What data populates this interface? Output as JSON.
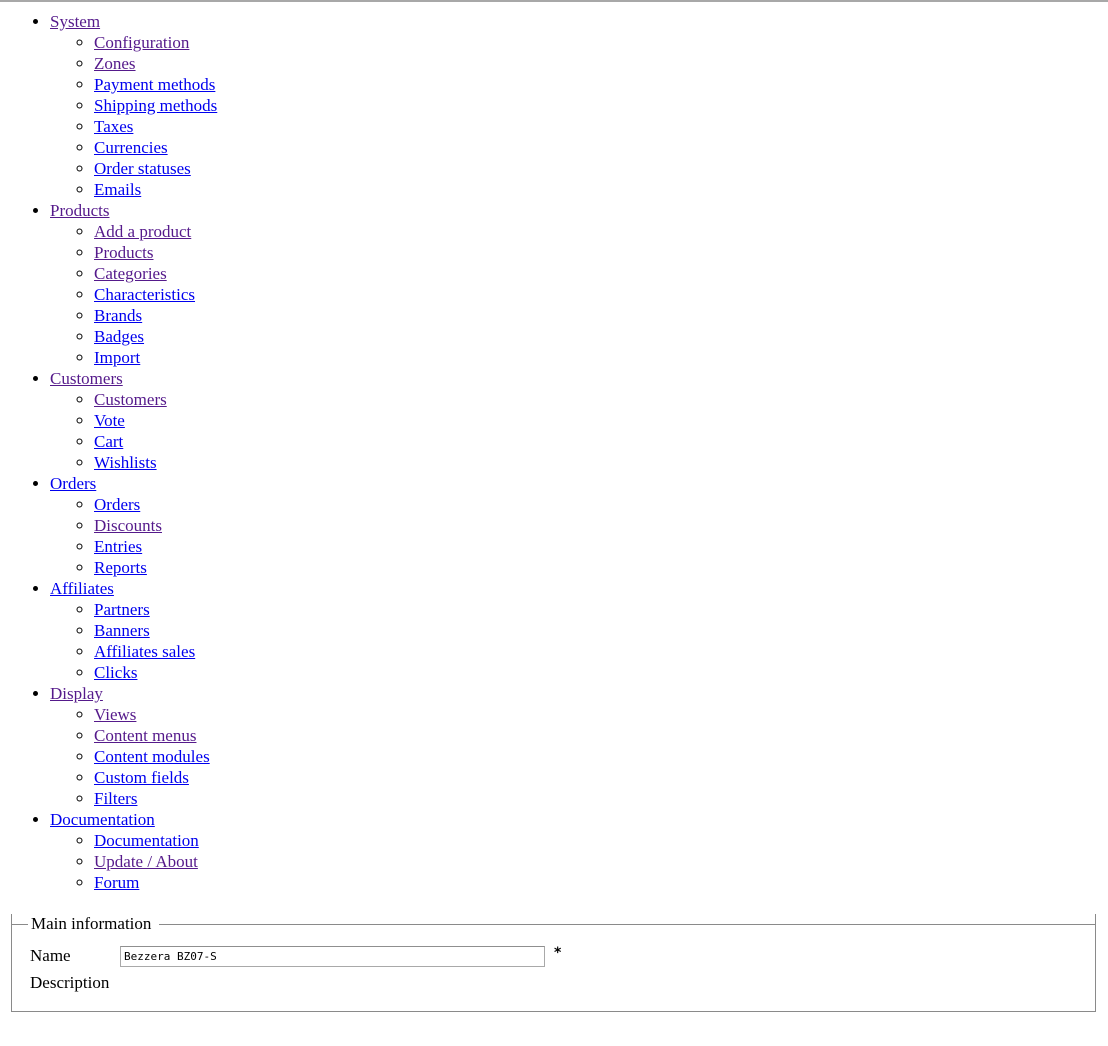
{
  "menu": [
    {
      "label": "System",
      "visited": true,
      "items": [
        {
          "label": "Configuration",
          "visited": true
        },
        {
          "label": "Zones",
          "visited": true
        },
        {
          "label": "Payment methods",
          "visited": false
        },
        {
          "label": "Shipping methods",
          "visited": false
        },
        {
          "label": "Taxes",
          "visited": false
        },
        {
          "label": "Currencies",
          "visited": false
        },
        {
          "label": "Order statuses",
          "visited": false
        },
        {
          "label": "Emails",
          "visited": false
        }
      ]
    },
    {
      "label": "Products",
      "visited": true,
      "items": [
        {
          "label": "Add a product",
          "visited": true
        },
        {
          "label": "Products",
          "visited": true
        },
        {
          "label": "Categories",
          "visited": true
        },
        {
          "label": "Characteristics",
          "visited": false
        },
        {
          "label": "Brands",
          "visited": false
        },
        {
          "label": "Badges",
          "visited": false
        },
        {
          "label": "Import",
          "visited": false
        }
      ]
    },
    {
      "label": "Customers",
      "visited": true,
      "items": [
        {
          "label": "Customers",
          "visited": true
        },
        {
          "label": "Vote",
          "visited": false
        },
        {
          "label": "Cart",
          "visited": false
        },
        {
          "label": "Wishlists",
          "visited": false
        }
      ]
    },
    {
      "label": "Orders",
      "visited": false,
      "items": [
        {
          "label": "Orders",
          "visited": false
        },
        {
          "label": "Discounts",
          "visited": true
        },
        {
          "label": "Entries",
          "visited": false
        },
        {
          "label": "Reports",
          "visited": false
        }
      ]
    },
    {
      "label": "Affiliates",
      "visited": false,
      "items": [
        {
          "label": "Partners",
          "visited": false
        },
        {
          "label": "Banners",
          "visited": false
        },
        {
          "label": "Affiliates sales",
          "visited": false
        },
        {
          "label": "Clicks",
          "visited": false
        }
      ]
    },
    {
      "label": "Display",
      "visited": true,
      "items": [
        {
          "label": "Views",
          "visited": true
        },
        {
          "label": "Content menus",
          "visited": true
        },
        {
          "label": "Content modules",
          "visited": false
        },
        {
          "label": "Custom fields",
          "visited": false
        },
        {
          "label": "Filters",
          "visited": false
        }
      ]
    },
    {
      "label": "Documentation",
      "visited": false,
      "items": [
        {
          "label": "Documentation",
          "visited": false
        },
        {
          "label": "Update / About",
          "visited": true
        },
        {
          "label": "Forum",
          "visited": false
        }
      ]
    }
  ],
  "form": {
    "legend": "Main information",
    "name_label": "Name",
    "name_value": "Bezzera BZ07-S",
    "required_mark": "*",
    "description_label": "Description"
  },
  "colors": {
    "link": "#0000ee",
    "visited_link": "#551a8b",
    "border": "#8a8a8a"
  }
}
